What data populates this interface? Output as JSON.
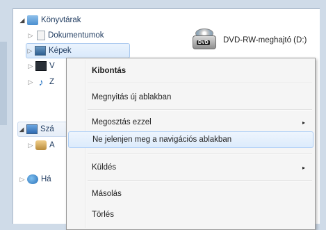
{
  "nav_tree": {
    "items": [
      {
        "label": "Könyvtárak",
        "expanded": true,
        "icon": "library-icon"
      },
      {
        "label": "Dokumentumok",
        "expanded": false,
        "icon": "documents-icon"
      },
      {
        "label": "Képek",
        "expanded": false,
        "icon": "pictures-icon",
        "selected": true
      },
      {
        "label": "V",
        "expanded": false,
        "icon": "videos-icon"
      },
      {
        "label": "Z",
        "expanded": false,
        "icon": "music-icon"
      },
      {
        "label": "Szá",
        "expanded": true,
        "icon": "computer-icon"
      },
      {
        "label": "A",
        "expanded": false,
        "icon": "user-icon"
      },
      {
        "label": "Há",
        "expanded": false,
        "icon": "network-icon"
      }
    ]
  },
  "content": {
    "drive_label": "DVD-RW-meghajtó (D:)",
    "drive_badge": "DVD"
  },
  "context_menu": {
    "items": [
      {
        "label": "Kibontás",
        "bold": true
      },
      {
        "label": "Megnyitás új ablakban"
      },
      {
        "label": "Megosztás ezzel",
        "submenu": true
      },
      {
        "label": "Ne jelenjen meg a navigációs ablakban",
        "hover": true
      },
      {
        "label": "Küldés",
        "submenu": true
      },
      {
        "label": "Másolás"
      },
      {
        "label": "Törlés"
      }
    ],
    "submenu_arrow": "▸"
  },
  "colors": {
    "frame": "#cfdbe8",
    "selection": "#d9e9fb",
    "menu_bg": "#f5f5f5"
  }
}
